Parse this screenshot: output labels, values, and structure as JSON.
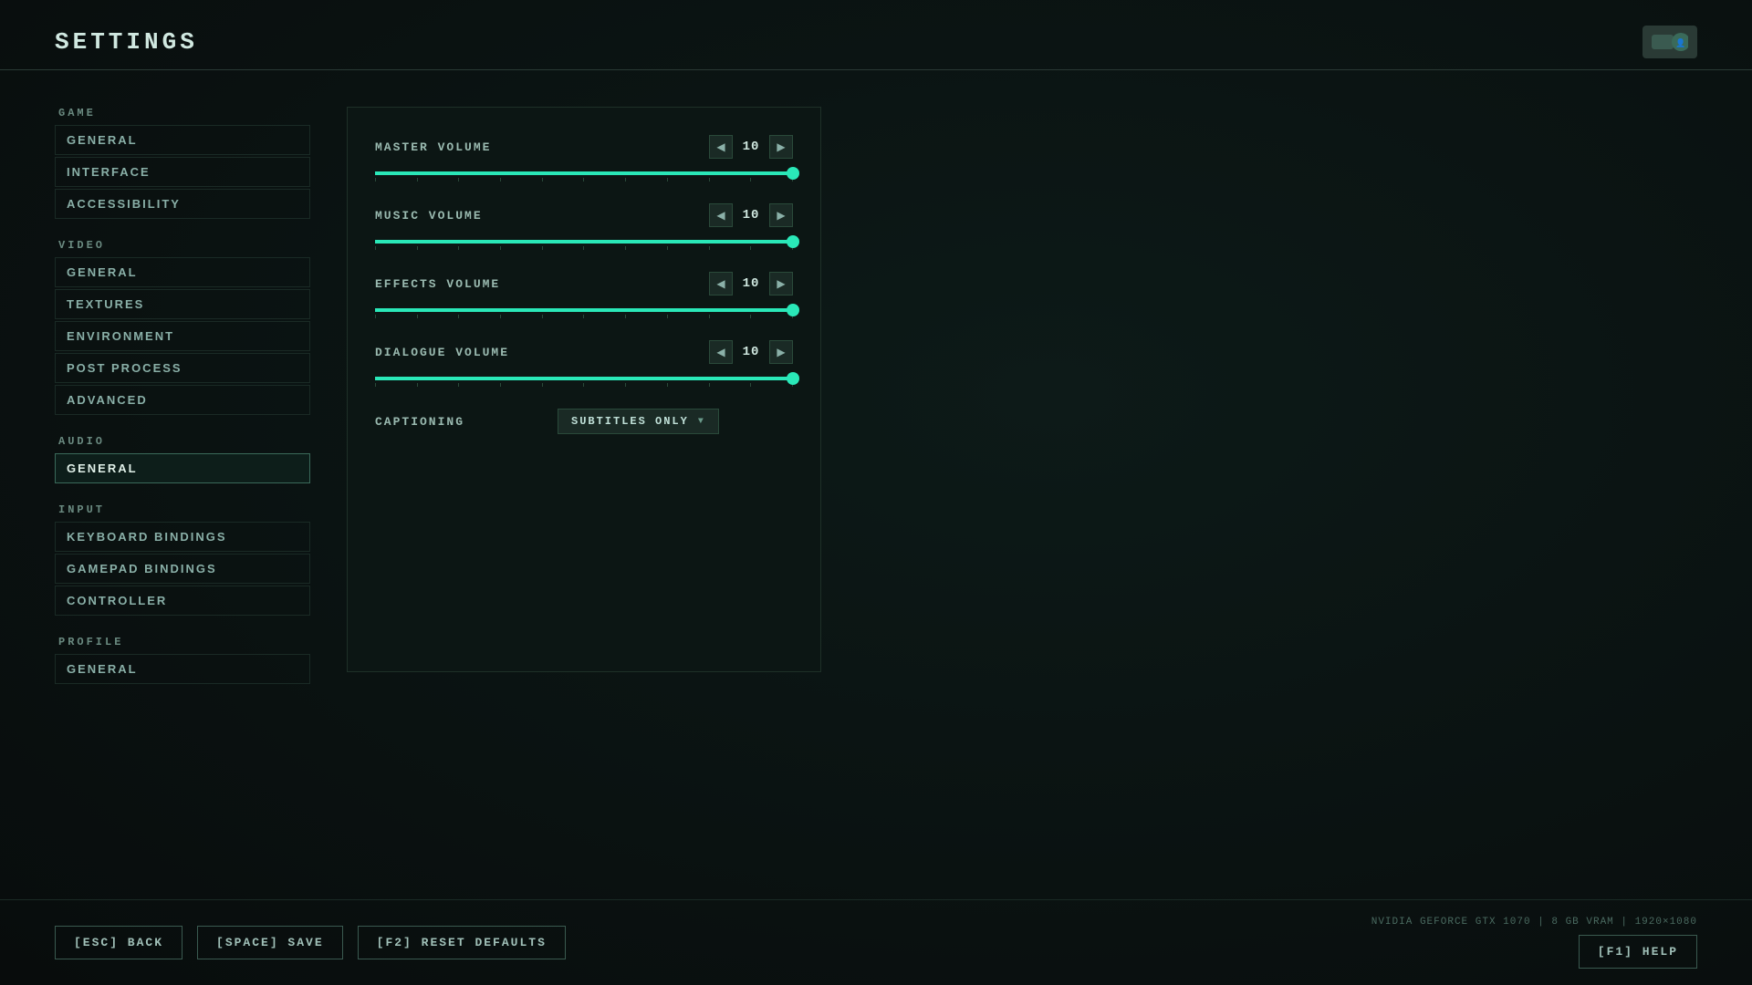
{
  "header": {
    "title": "SETTINGS"
  },
  "sidebar": {
    "sections": [
      {
        "label": "GAME",
        "items": [
          {
            "id": "game-general",
            "label": "GENERAL",
            "active": false
          },
          {
            "id": "game-interface",
            "label": "INTERFACE",
            "active": false
          },
          {
            "id": "game-accessibility",
            "label": "ACCESSIBILITY",
            "active": false
          }
        ]
      },
      {
        "label": "VIDEO",
        "items": [
          {
            "id": "video-general",
            "label": "GENERAL",
            "active": false
          },
          {
            "id": "video-textures",
            "label": "TEXTURES",
            "active": false
          },
          {
            "id": "video-environment",
            "label": "ENVIRONMENT",
            "active": false
          },
          {
            "id": "video-postprocess",
            "label": "POST PROCESS",
            "active": false
          },
          {
            "id": "video-advanced",
            "label": "ADVANCED",
            "active": false
          }
        ]
      },
      {
        "label": "AUDIO",
        "items": [
          {
            "id": "audio-general",
            "label": "GENERAL",
            "active": true
          }
        ]
      },
      {
        "label": "INPUT",
        "items": [
          {
            "id": "input-keyboard",
            "label": "KEYBOARD BINDINGS",
            "active": false
          },
          {
            "id": "input-gamepad",
            "label": "GAMEPAD BINDINGS",
            "active": false
          },
          {
            "id": "input-controller",
            "label": "CONTROLLER",
            "active": false
          }
        ]
      },
      {
        "label": "PROFILE",
        "items": [
          {
            "id": "profile-general",
            "label": "GENERAL",
            "active": false
          }
        ]
      }
    ]
  },
  "content": {
    "settings": [
      {
        "id": "master-volume",
        "label": "MASTER VOLUME",
        "value": 10,
        "max": 10,
        "percent": 100
      },
      {
        "id": "music-volume",
        "label": "MUSIC VOLUME",
        "value": 10,
        "max": 10,
        "percent": 100
      },
      {
        "id": "effects-volume",
        "label": "EFFECTS VOLUME",
        "value": 10,
        "max": 10,
        "percent": 100
      },
      {
        "id": "dialogue-volume",
        "label": "DIALOGUE VOLUME",
        "value": 10,
        "max": 10,
        "percent": 100
      }
    ],
    "captioning": {
      "label": "CAPTIONING",
      "value": "SUBTITLES ONLY"
    }
  },
  "footer": {
    "back_label": "[ESC] BACK",
    "save_label": "[SPACE] SAVE",
    "reset_label": "[F2] RESET DEFAULTS",
    "help_label": "[F1] HELP",
    "sys_info": "NVIDIA GEFORCE GTX 1070 | 8 GB VRAM | 1920×1080"
  }
}
